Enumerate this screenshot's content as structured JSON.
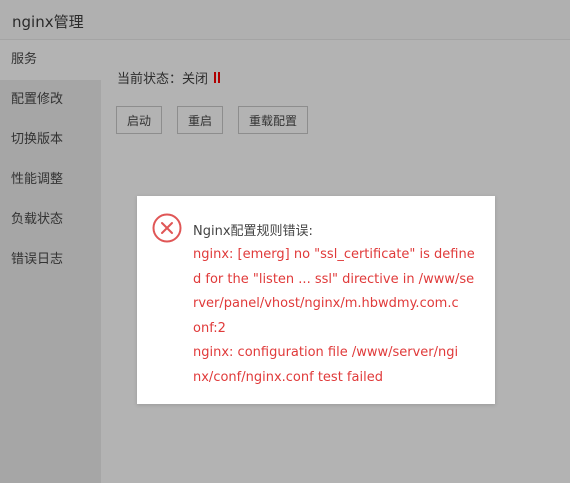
{
  "app": {
    "title": "nginx管理"
  },
  "sidebar": {
    "items": [
      {
        "label": "服务",
        "active": true
      },
      {
        "label": "配置修改"
      },
      {
        "label": "切换版本"
      },
      {
        "label": "性能调整"
      },
      {
        "label": "负载状态"
      },
      {
        "label": "错误日志"
      }
    ]
  },
  "main": {
    "status_label": "当前状态：关闭",
    "status_icon": "pause-icon",
    "status_color": "#b00000",
    "buttons": {
      "start": "启动",
      "restart": "重启",
      "reload": "重载配置"
    }
  },
  "dialog": {
    "icon": "error-icon",
    "title": "Nginx配置规则错误:",
    "lines": [
      "nginx: [emerg] no \"ssl_certificate\" is define",
      "d for the \"listen ... ssl\" directive in /www/se",
      "rver/panel/vhost/nginx/m.hbwdmy.com.c",
      "onf:2",
      "nginx: configuration file /www/server/ngi",
      "nx/conf/nginx.conf test failed"
    ],
    "error_color": "#e03a3a"
  }
}
